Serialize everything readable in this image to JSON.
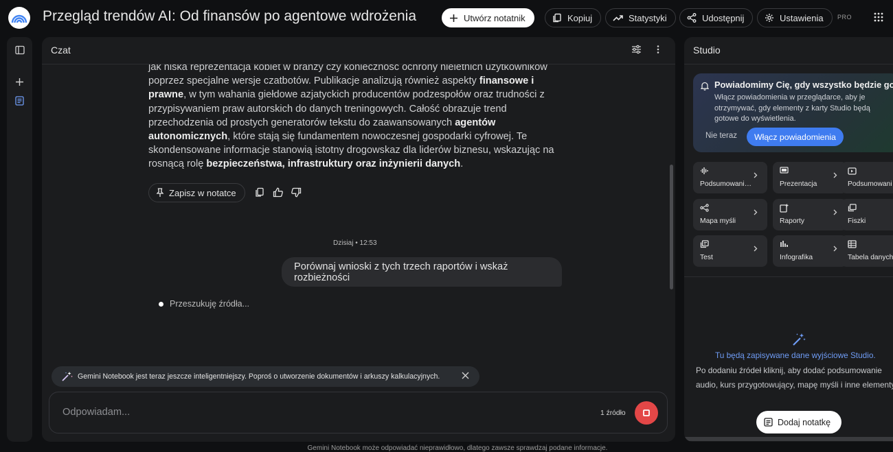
{
  "header": {
    "title": "Przegląd trendów AI: Od finansów po agentowe wdrożenia",
    "create_notebook": "Utwórz notatnik",
    "copy": "Kopiuj",
    "stats": "Statystyki",
    "share": "Udostępnij",
    "settings": "Ustawienia",
    "pro_badge": "PRO"
  },
  "chat": {
    "title": "Czat",
    "message": {
      "p1": "jak niska reprezentacja kobiet w branży czy konieczność ochrony nieletnich użytkowników poprzez specjalne wersje czatbotów. Publikacje analizują również aspekty ",
      "b1": "finansowe i prawne",
      "p2": ", w tym wahania giełdowe azjatyckich producentów podzespołów oraz trudności z przypisywaniem praw autorskich do danych treningowych. Całość obrazuje trend przechodzenia od prostych generatorów tekstu do zaawansowanych ",
      "b2": "agentów autonomicznych",
      "p3": ", które stają się fundamentem nowoczesnej gospodarki cyfrowej. Te skondensowane informacje stanowią istotny drogowskaz dla liderów biznesu, wskazując na rosnącą rolę ",
      "b3": "bezpieczeństwa, infrastruktury oraz inżynierii danych",
      "p4": "."
    },
    "save_to_note": "Zapisz w notatce",
    "timestamp": "Dzisiaj • 12:53",
    "user_message": "Porównaj wnioski z tych trzech raportów i wskaż rozbieżności",
    "searching": "Przeszukuję źródła...",
    "banner": "Gemini Notebook jest teraz jeszcze inteligentniejszy. Poproś o utworzenie dokumentów i arkuszy kalkulacyjnych.",
    "input_placeholder": "Odpowiadam...",
    "source_count": "1 źródło"
  },
  "studio": {
    "title": "Studio",
    "notification": {
      "heading": "Powiadomimy Cię, gdy wszystko będzie gotowe",
      "body": "Włącz powiadomienia w przeglądarce, aby je otrzymywać, gdy elementy z karty Studio będą gotowe do wyświetlenia.",
      "not_now": "Nie teraz",
      "enable": "Włącz powiadomienia"
    },
    "tiles": [
      {
        "label": "Podsumowanie audio",
        "icon": "audio-waveform-icon"
      },
      {
        "label": "Prezentacja",
        "icon": "presentation-icon"
      },
      {
        "label": "Podsumowanie wideo",
        "icon": "video-icon"
      },
      {
        "label": "Mapa myśli",
        "icon": "mind-map-icon"
      },
      {
        "label": "Raporty",
        "icon": "report-icon"
      },
      {
        "label": "Fiszki",
        "icon": "flashcards-icon"
      },
      {
        "label": "Test",
        "icon": "quiz-icon"
      },
      {
        "label": "Infografika",
        "icon": "infographic-icon"
      },
      {
        "label": "Tabela danych",
        "icon": "table-icon"
      }
    ],
    "empty_title": "Tu będą zapisywane dane wyjściowe Studio.",
    "empty_body": "Po dodaniu źródeł kliknij, aby dodać podsumowanie audio, kurs przygotowujący, mapę myśli i inne elementy.",
    "add_note": "Dodaj notatkę"
  },
  "footer": "Gemini Notebook może odpowiadać nieprawidłowo, dlatego zawsze sprawdzaj podane informacje.",
  "colors": {
    "background": "#0f1012",
    "panel": "#1b1c1e",
    "accent_blue": "#3f7cf0",
    "stop_red": "#e34747"
  }
}
